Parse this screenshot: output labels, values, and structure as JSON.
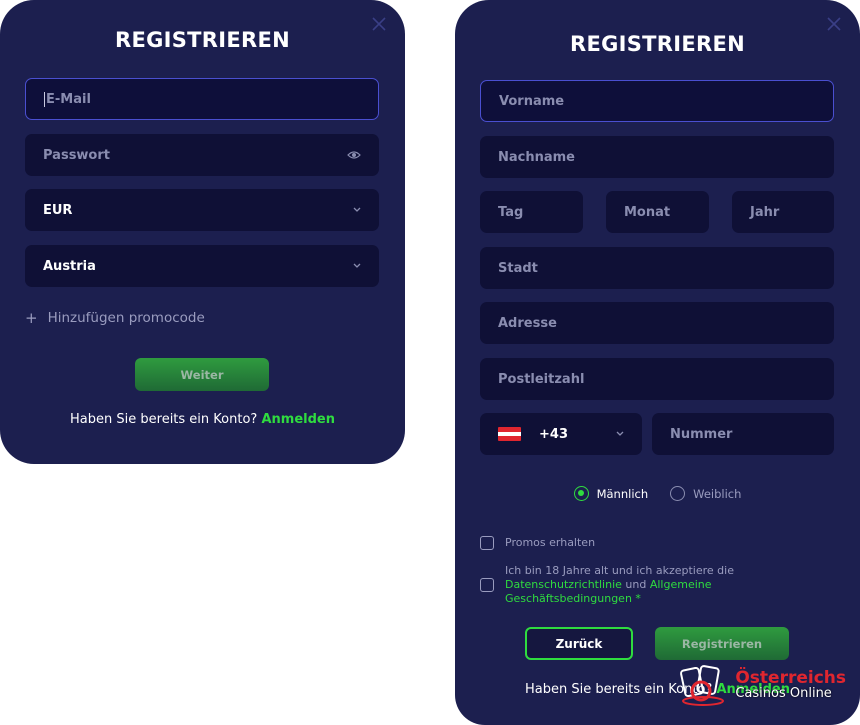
{
  "left_form": {
    "title": "REGISTRIEREN",
    "email_placeholder": "E-Mail",
    "password_placeholder": "Passwort",
    "currency_value": "EUR",
    "country_value": "Austria",
    "promo_plus": "+",
    "promo_label": "Hinzufügen promocode",
    "submit_label": "Weiter",
    "footer_text": "Haben Sie bereits ein Konto?",
    "footer_link": "Anmelden"
  },
  "right_form": {
    "title": "REGISTRIEREN",
    "firstname_placeholder": "Vorname",
    "lastname_placeholder": "Nachname",
    "day_placeholder": "Tag",
    "month_placeholder": "Monat",
    "year_placeholder": "Jahr",
    "city_placeholder": "Stadt",
    "address_placeholder": "Adresse",
    "zip_placeholder": "Postleitzahl",
    "phone_code": "+43",
    "phone_placeholder": "Nummer",
    "gender_male": "Männlich",
    "gender_female": "Weiblich",
    "promos_label": "Promos erhalten",
    "terms_prefix": "Ich bin 18 Jahre alt und ich akzeptiere die",
    "terms_link_privacy": "Datenschutzrichtlinie",
    "terms_and": "und",
    "terms_link_general": "Allgemeine",
    "terms_link_business": "Geschäftsbedingungen",
    "terms_required": "*",
    "back_label": "Zurück",
    "register_label": "Registrieren",
    "footer_text": "Haben Sie bereits ein Konto?",
    "footer_link": "Anmelden"
  },
  "watermark": {
    "top": "Österreichs",
    "bottom": "Casinos Online"
  },
  "colors": {
    "panel_bg": "#1c1f4f",
    "field_bg": "#0f1036",
    "accent_green": "#2fdc3f",
    "focus_border": "#4a4fd0"
  }
}
